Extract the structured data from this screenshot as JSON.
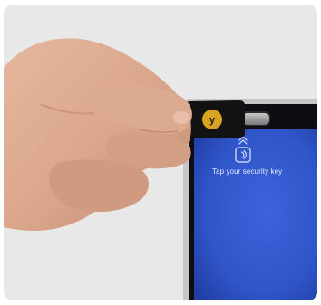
{
  "photo": {
    "subject": "hand-inserting-security-key",
    "screen_prompt": "Tap your security key",
    "icons": {
      "nfc": "nfc-icon",
      "chevron": "chevron-up-icon",
      "key_logo": "yubico-logo-icon"
    },
    "colors": {
      "background": "#e8e8e8",
      "screen_blue": "#2f55c9",
      "key_body": "#121212",
      "key_logo_gold": "#d8a320",
      "skin": "#d9a58a"
    }
  }
}
